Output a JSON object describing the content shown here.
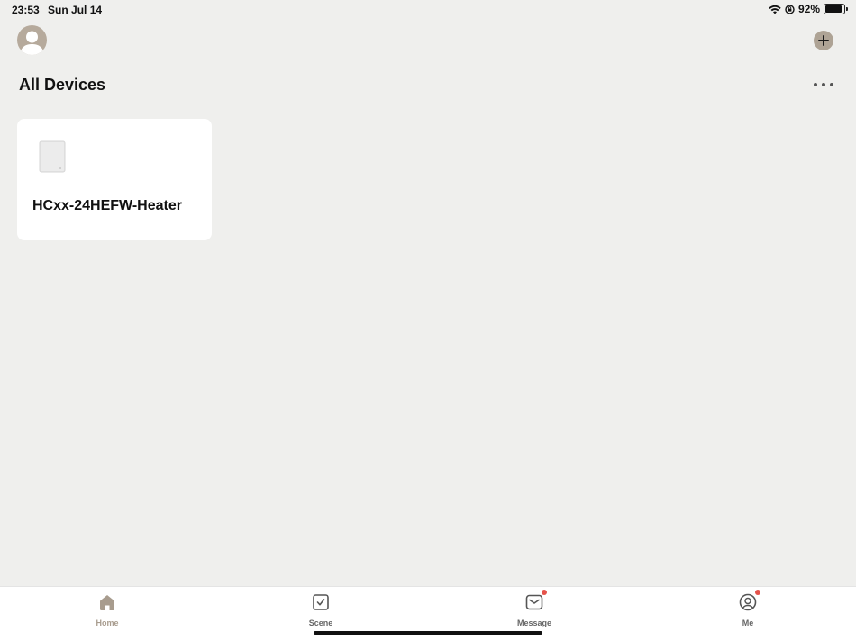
{
  "status_bar": {
    "time": "23:53",
    "date": "Sun Jul 14",
    "battery_percent": "92%",
    "battery_level": 0.92
  },
  "header": {
    "title": "All Devices",
    "avatar_icon": "user-avatar-icon",
    "add_icon": "plus-icon",
    "more_icon": "more-horizontal-icon"
  },
  "devices": [
    {
      "name": "HCxx-24HEFW-Heater",
      "icon": "heater-panel-icon"
    }
  ],
  "tabs": [
    {
      "label": "Home",
      "icon": "home-icon",
      "active": true,
      "badge": false
    },
    {
      "label": "Scene",
      "icon": "checkbox-icon",
      "active": false,
      "badge": false
    },
    {
      "label": "Message",
      "icon": "mail-icon",
      "active": false,
      "badge": true
    },
    {
      "label": "Me",
      "icon": "profile-icon",
      "active": false,
      "badge": true
    }
  ],
  "colors": {
    "background": "#efefed",
    "accent": "#a89c8e",
    "badge": "#e5534b",
    "card": "#ffffff"
  }
}
